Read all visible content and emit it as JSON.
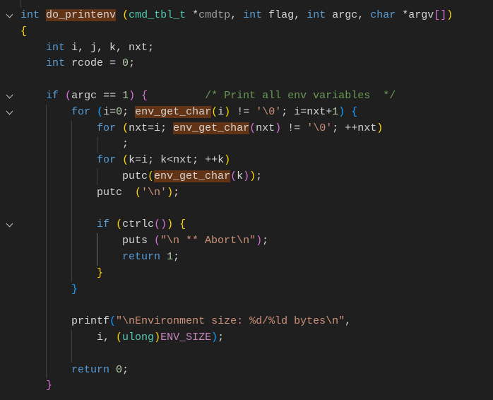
{
  "editor": {
    "theme_colors": {
      "background": "#1f1f1f",
      "keyword": "#569cd6",
      "type": "#4ec9b0",
      "string": "#ce9178",
      "number": "#b5cea8",
      "comment": "#6a9955",
      "highlight": "#623315"
    },
    "folded_lines_icon": "chevron-down-icon",
    "lines": [
      {
        "fold": true,
        "tokens": [
          [
            "int",
            "kw"
          ],
          [
            " "
          ],
          [
            "do_printenv",
            "hl"
          ],
          [
            " "
          ],
          [
            "(",
            "b1"
          ],
          [
            "cmd_tbl_t",
            "ty"
          ],
          [
            " *"
          ],
          [
            "cmdtp",
            "dim"
          ],
          [
            ", "
          ],
          [
            "int",
            "kw"
          ],
          [
            " flag, "
          ],
          [
            "int",
            "kw"
          ],
          [
            " argc, "
          ],
          [
            "char",
            "kw"
          ],
          [
            " *argv"
          ],
          [
            "[]",
            "b2"
          ],
          [
            ")",
            "b1"
          ]
        ]
      },
      {
        "tokens": [
          [
            "{",
            "b1"
          ]
        ]
      },
      {
        "tokens": [
          [
            "    "
          ],
          [
            "int",
            "kw"
          ],
          [
            " i, j, k, nxt;"
          ]
        ]
      },
      {
        "tokens": [
          [
            "    "
          ],
          [
            "int",
            "kw"
          ],
          [
            " rcode = "
          ],
          [
            "0",
            "num"
          ],
          [
            ";"
          ]
        ]
      },
      {
        "tokens": []
      },
      {
        "fold": true,
        "tokens": [
          [
            "    "
          ],
          [
            "if",
            "kw"
          ],
          [
            " "
          ],
          [
            "(",
            "b2"
          ],
          [
            "argc == "
          ],
          [
            "1",
            "num"
          ],
          [
            ")",
            "b2"
          ],
          [
            " "
          ],
          [
            "{",
            "b2"
          ],
          [
            "         "
          ],
          [
            "/* Print all env variables  */",
            "cm"
          ]
        ]
      },
      {
        "fold": true,
        "tokens": [
          [
            "        "
          ],
          [
            "for",
            "kw"
          ],
          [
            " "
          ],
          [
            "(",
            "b3"
          ],
          [
            "i="
          ],
          [
            "0",
            "num"
          ],
          [
            "; "
          ],
          [
            "env_get_char",
            "hl"
          ],
          [
            "(",
            "b1"
          ],
          [
            "i"
          ],
          [
            ")",
            "b1"
          ],
          [
            " != "
          ],
          [
            "'\\0'",
            "str"
          ],
          [
            "; i=nxt+"
          ],
          [
            "1",
            "num"
          ],
          [
            ")",
            "b3"
          ],
          [
            " "
          ],
          [
            "{",
            "b3"
          ]
        ]
      },
      {
        "tokens": [
          [
            "            "
          ],
          [
            "for",
            "kw"
          ],
          [
            " "
          ],
          [
            "(",
            "b1"
          ],
          [
            "nxt=i; "
          ],
          [
            "env_get_char",
            "hl"
          ],
          [
            "(",
            "b2"
          ],
          [
            "nxt"
          ],
          [
            ")",
            "b2"
          ],
          [
            " != "
          ],
          [
            "'\\0'",
            "str"
          ],
          [
            "; ++nxt"
          ],
          [
            ")",
            "b1"
          ]
        ]
      },
      {
        "tokens": [
          [
            "                ;"
          ]
        ]
      },
      {
        "tokens": [
          [
            "            "
          ],
          [
            "for",
            "kw"
          ],
          [
            " "
          ],
          [
            "(",
            "b1"
          ],
          [
            "k=i; k<nxt; ++k"
          ],
          [
            ")",
            "b1"
          ]
        ]
      },
      {
        "tokens": [
          [
            "                putc"
          ],
          [
            "(",
            "b1"
          ],
          [
            "env_get_char",
            "hl"
          ],
          [
            "(",
            "b2"
          ],
          [
            "k"
          ],
          [
            ")",
            "b2"
          ],
          [
            ")",
            "b1"
          ],
          [
            ";"
          ]
        ]
      },
      {
        "tokens": [
          [
            "            putc  "
          ],
          [
            "(",
            "b1"
          ],
          [
            "'\\n'",
            "str"
          ],
          [
            ")",
            "b1"
          ],
          [
            ";"
          ]
        ]
      },
      {
        "tokens": []
      },
      {
        "fold": true,
        "tokens": [
          [
            "            "
          ],
          [
            "if",
            "kw"
          ],
          [
            " "
          ],
          [
            "(",
            "b1"
          ],
          [
            "ctrlc"
          ],
          [
            "()",
            "b2"
          ],
          [
            ")",
            "b1"
          ],
          [
            " "
          ],
          [
            "{",
            "b1"
          ]
        ]
      },
      {
        "tokens": [
          [
            "                puts "
          ],
          [
            "(",
            "b2"
          ],
          [
            "\"\\n ** Abort\\n\"",
            "str"
          ],
          [
            ")",
            "b2"
          ],
          [
            ";"
          ]
        ]
      },
      {
        "tokens": [
          [
            "                "
          ],
          [
            "return",
            "kw"
          ],
          [
            " "
          ],
          [
            "1",
            "num"
          ],
          [
            ";"
          ]
        ]
      },
      {
        "tokens": [
          [
            "            "
          ],
          [
            "}",
            "b1"
          ]
        ]
      },
      {
        "tokens": [
          [
            "        "
          ],
          [
            "}",
            "b3"
          ]
        ]
      },
      {
        "tokens": []
      },
      {
        "tokens": [
          [
            "        printf"
          ],
          [
            "(",
            "b3"
          ],
          [
            "\"\\nEnvironment size: %d/%ld bytes\\n\"",
            "str"
          ],
          [
            ","
          ]
        ]
      },
      {
        "tokens": [
          [
            "            i, "
          ],
          [
            "(",
            "b1"
          ],
          [
            "ulong",
            "ty"
          ],
          [
            ")",
            "b1"
          ],
          [
            "ENV_SIZE",
            "mac"
          ],
          [
            ")",
            "b3"
          ],
          [
            ";"
          ]
        ]
      },
      {
        "tokens": []
      },
      {
        "tokens": [
          [
            "        "
          ],
          [
            "return",
            "kw"
          ],
          [
            " "
          ],
          [
            "0",
            "num"
          ],
          [
            ";"
          ]
        ]
      },
      {
        "tokens": [
          [
            "    "
          ],
          [
            "}",
            "b2"
          ]
        ]
      }
    ]
  }
}
